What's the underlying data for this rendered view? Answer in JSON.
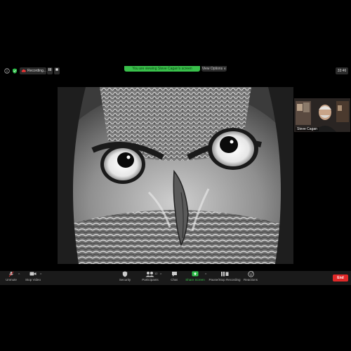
{
  "topbar": {
    "recording_label": "Recording...",
    "pause_icon": "pause-icon",
    "stop_icon": "stop-icon",
    "share_banner": "You are viewing Steve Cagan's screen",
    "view_options": "View Options ∨",
    "timer": "33:46"
  },
  "participant": {
    "name": "Steve Cagan"
  },
  "toolbar": {
    "unmute": "Unmute",
    "stop_video": "Stop Video",
    "security": "Security",
    "participants": "Participants",
    "participants_count": "12",
    "chat": "Chat",
    "share_screen": "Share Screen",
    "pause_stop_recording": "Pause/Stop Recording",
    "reactions": "Reactions",
    "end": "End"
  },
  "colors": {
    "share_green": "#39c04b",
    "end_red": "#e02828",
    "toolbar_bg": "#1a1a1a"
  }
}
